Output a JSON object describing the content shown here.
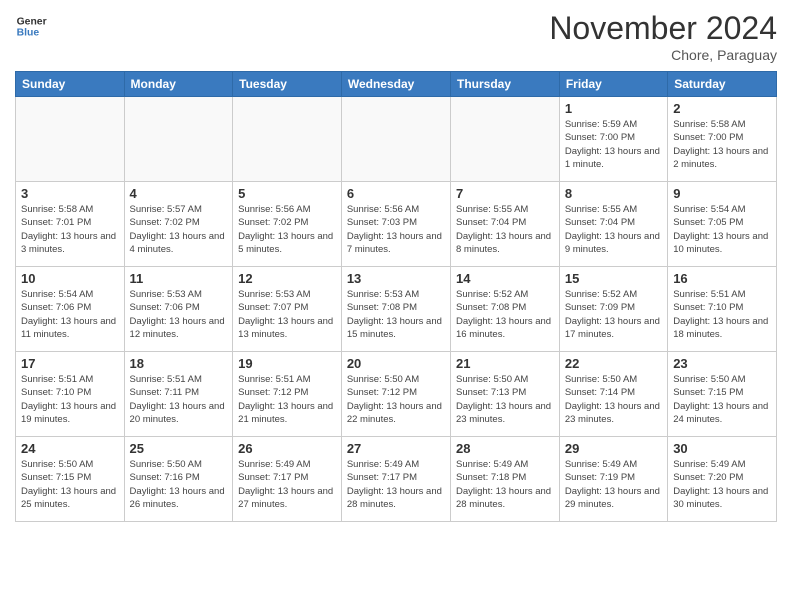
{
  "header": {
    "logo_line1": "General",
    "logo_line2": "Blue",
    "month": "November 2024",
    "location": "Chore, Paraguay"
  },
  "weekdays": [
    "Sunday",
    "Monday",
    "Tuesday",
    "Wednesday",
    "Thursday",
    "Friday",
    "Saturday"
  ],
  "weeks": [
    [
      {
        "day": "",
        "info": ""
      },
      {
        "day": "",
        "info": ""
      },
      {
        "day": "",
        "info": ""
      },
      {
        "day": "",
        "info": ""
      },
      {
        "day": "",
        "info": ""
      },
      {
        "day": "1",
        "info": "Sunrise: 5:59 AM\nSunset: 7:00 PM\nDaylight: 13 hours and 1 minute."
      },
      {
        "day": "2",
        "info": "Sunrise: 5:58 AM\nSunset: 7:00 PM\nDaylight: 13 hours and 2 minutes."
      }
    ],
    [
      {
        "day": "3",
        "info": "Sunrise: 5:58 AM\nSunset: 7:01 PM\nDaylight: 13 hours and 3 minutes."
      },
      {
        "day": "4",
        "info": "Sunrise: 5:57 AM\nSunset: 7:02 PM\nDaylight: 13 hours and 4 minutes."
      },
      {
        "day": "5",
        "info": "Sunrise: 5:56 AM\nSunset: 7:02 PM\nDaylight: 13 hours and 5 minutes."
      },
      {
        "day": "6",
        "info": "Sunrise: 5:56 AM\nSunset: 7:03 PM\nDaylight: 13 hours and 7 minutes."
      },
      {
        "day": "7",
        "info": "Sunrise: 5:55 AM\nSunset: 7:04 PM\nDaylight: 13 hours and 8 minutes."
      },
      {
        "day": "8",
        "info": "Sunrise: 5:55 AM\nSunset: 7:04 PM\nDaylight: 13 hours and 9 minutes."
      },
      {
        "day": "9",
        "info": "Sunrise: 5:54 AM\nSunset: 7:05 PM\nDaylight: 13 hours and 10 minutes."
      }
    ],
    [
      {
        "day": "10",
        "info": "Sunrise: 5:54 AM\nSunset: 7:06 PM\nDaylight: 13 hours and 11 minutes."
      },
      {
        "day": "11",
        "info": "Sunrise: 5:53 AM\nSunset: 7:06 PM\nDaylight: 13 hours and 12 minutes."
      },
      {
        "day": "12",
        "info": "Sunrise: 5:53 AM\nSunset: 7:07 PM\nDaylight: 13 hours and 13 minutes."
      },
      {
        "day": "13",
        "info": "Sunrise: 5:53 AM\nSunset: 7:08 PM\nDaylight: 13 hours and 15 minutes."
      },
      {
        "day": "14",
        "info": "Sunrise: 5:52 AM\nSunset: 7:08 PM\nDaylight: 13 hours and 16 minutes."
      },
      {
        "day": "15",
        "info": "Sunrise: 5:52 AM\nSunset: 7:09 PM\nDaylight: 13 hours and 17 minutes."
      },
      {
        "day": "16",
        "info": "Sunrise: 5:51 AM\nSunset: 7:10 PM\nDaylight: 13 hours and 18 minutes."
      }
    ],
    [
      {
        "day": "17",
        "info": "Sunrise: 5:51 AM\nSunset: 7:10 PM\nDaylight: 13 hours and 19 minutes."
      },
      {
        "day": "18",
        "info": "Sunrise: 5:51 AM\nSunset: 7:11 PM\nDaylight: 13 hours and 20 minutes."
      },
      {
        "day": "19",
        "info": "Sunrise: 5:51 AM\nSunset: 7:12 PM\nDaylight: 13 hours and 21 minutes."
      },
      {
        "day": "20",
        "info": "Sunrise: 5:50 AM\nSunset: 7:12 PM\nDaylight: 13 hours and 22 minutes."
      },
      {
        "day": "21",
        "info": "Sunrise: 5:50 AM\nSunset: 7:13 PM\nDaylight: 13 hours and 23 minutes."
      },
      {
        "day": "22",
        "info": "Sunrise: 5:50 AM\nSunset: 7:14 PM\nDaylight: 13 hours and 23 minutes."
      },
      {
        "day": "23",
        "info": "Sunrise: 5:50 AM\nSunset: 7:15 PM\nDaylight: 13 hours and 24 minutes."
      }
    ],
    [
      {
        "day": "24",
        "info": "Sunrise: 5:50 AM\nSunset: 7:15 PM\nDaylight: 13 hours and 25 minutes."
      },
      {
        "day": "25",
        "info": "Sunrise: 5:50 AM\nSunset: 7:16 PM\nDaylight: 13 hours and 26 minutes."
      },
      {
        "day": "26",
        "info": "Sunrise: 5:49 AM\nSunset: 7:17 PM\nDaylight: 13 hours and 27 minutes."
      },
      {
        "day": "27",
        "info": "Sunrise: 5:49 AM\nSunset: 7:17 PM\nDaylight: 13 hours and 28 minutes."
      },
      {
        "day": "28",
        "info": "Sunrise: 5:49 AM\nSunset: 7:18 PM\nDaylight: 13 hours and 28 minutes."
      },
      {
        "day": "29",
        "info": "Sunrise: 5:49 AM\nSunset: 7:19 PM\nDaylight: 13 hours and 29 minutes."
      },
      {
        "day": "30",
        "info": "Sunrise: 5:49 AM\nSunset: 7:20 PM\nDaylight: 13 hours and 30 minutes."
      }
    ]
  ]
}
